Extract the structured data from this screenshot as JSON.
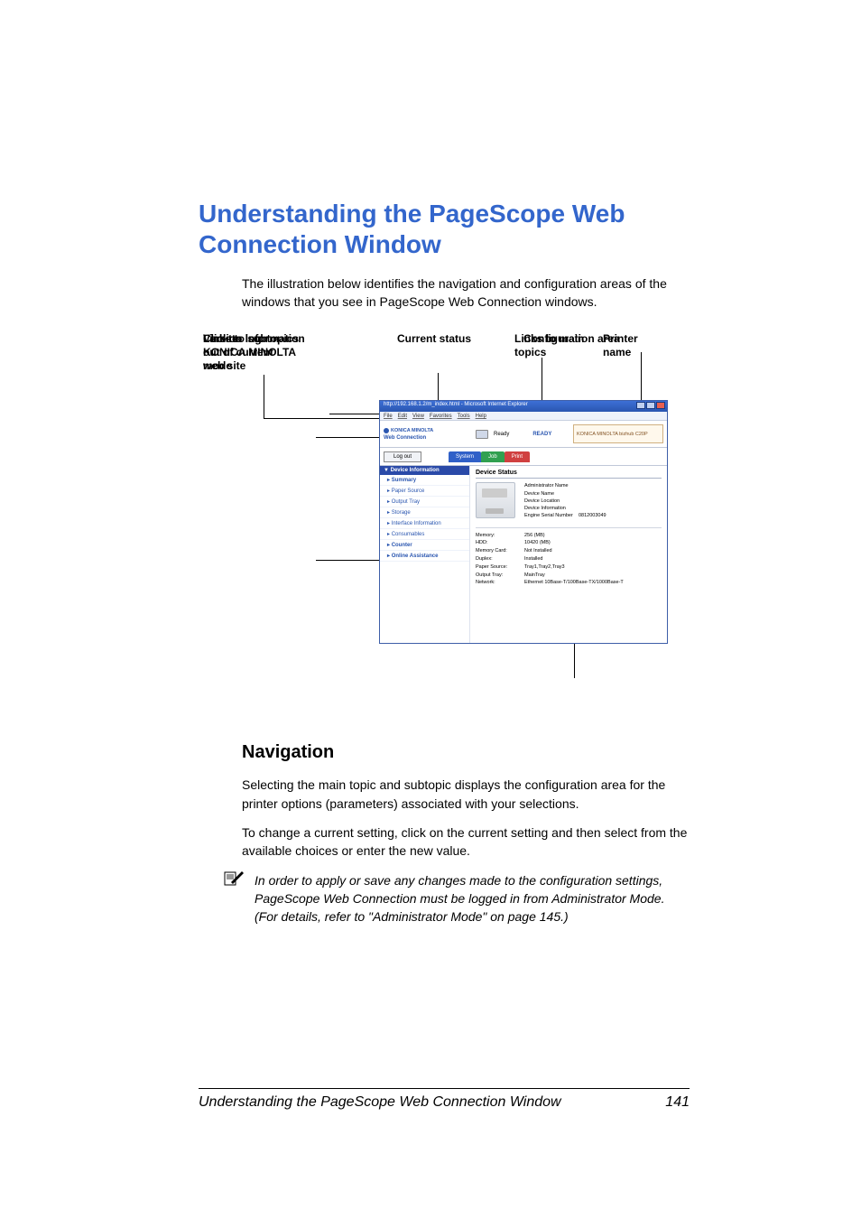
{
  "title": "Understanding the PageScope Web Connection Window",
  "intro": "The illustration below identifies the navigation and configuration areas of the windows that you see in PageScope Web Connection windows.",
  "labels": {
    "link_km": "Link to\nKONICA MINOLTA\nweb site",
    "current_status": "Current status",
    "links_main": "Links to main topics",
    "printer_name": "Printer name",
    "version_info": "Version information",
    "click_logout": "Click to log out of current mode",
    "links_subtopics": "Links to subtopics",
    "config_area": "Configuration area"
  },
  "browser": {
    "titlebar": "http://192.168.1.2/m_index.html - Microsoft Internet Explorer",
    "menu": [
      "File",
      "Edit",
      "View",
      "Favorites",
      "Tools",
      "Help"
    ],
    "brand": "KONICA MINOLTA",
    "webconn": "Web Connection",
    "status_ready": "Ready",
    "status_badge": "READY",
    "printer_name_box": "KONICA MINOLTA bizhub C20P",
    "logout": "Log out",
    "tabs": {
      "system": "System",
      "job": "Job",
      "print": "Print"
    },
    "sidebar_header": "Device Information",
    "sidebar_items": [
      "Summary",
      "Paper Source",
      "Output Tray",
      "Storage",
      "Interface Information",
      "Consumables",
      "Counter",
      "Online Assistance"
    ],
    "main_title": "Device Status",
    "info_rows": [
      {
        "k": "Administrator Name",
        "v": ""
      },
      {
        "k": "Device Name",
        "v": ""
      },
      {
        "k": "Device Location",
        "v": ""
      },
      {
        "k": "Device Information",
        "v": ""
      },
      {
        "k": "Engine Serial Number",
        "v": "0812003049"
      }
    ],
    "spec_rows": [
      {
        "k": "Memory:",
        "v": "256 (MB)"
      },
      {
        "k": "HDD:",
        "v": "10420 (MB)"
      },
      {
        "k": "Memory Card:",
        "v": "Not Installed"
      },
      {
        "k": "Duplex:",
        "v": "Installed"
      },
      {
        "k": "Paper Source:",
        "v": "Tray1,Tray2,Tray3"
      },
      {
        "k": "Output Tray:",
        "v": "MainTray"
      },
      {
        "k": "Network:",
        "v": "Ethernet 10Base-T/100Base-TX/1000Base-T"
      }
    ]
  },
  "nav_heading": "Navigation",
  "nav_p1": "Selecting the main topic and subtopic displays the configuration area for the printer options (parameters) associated with your selections.",
  "nav_p2": "To change a current setting, click on the current setting and then select from the available choices or enter the new value.",
  "note": "In order to apply or save any changes made to the configuration settings, PageScope Web Connection must be logged in from Administrator Mode. (For details, refer to \"Administrator Mode\" on page 145.)",
  "footer_text": "Understanding the PageScope Web Connection Window",
  "page_number": "141"
}
